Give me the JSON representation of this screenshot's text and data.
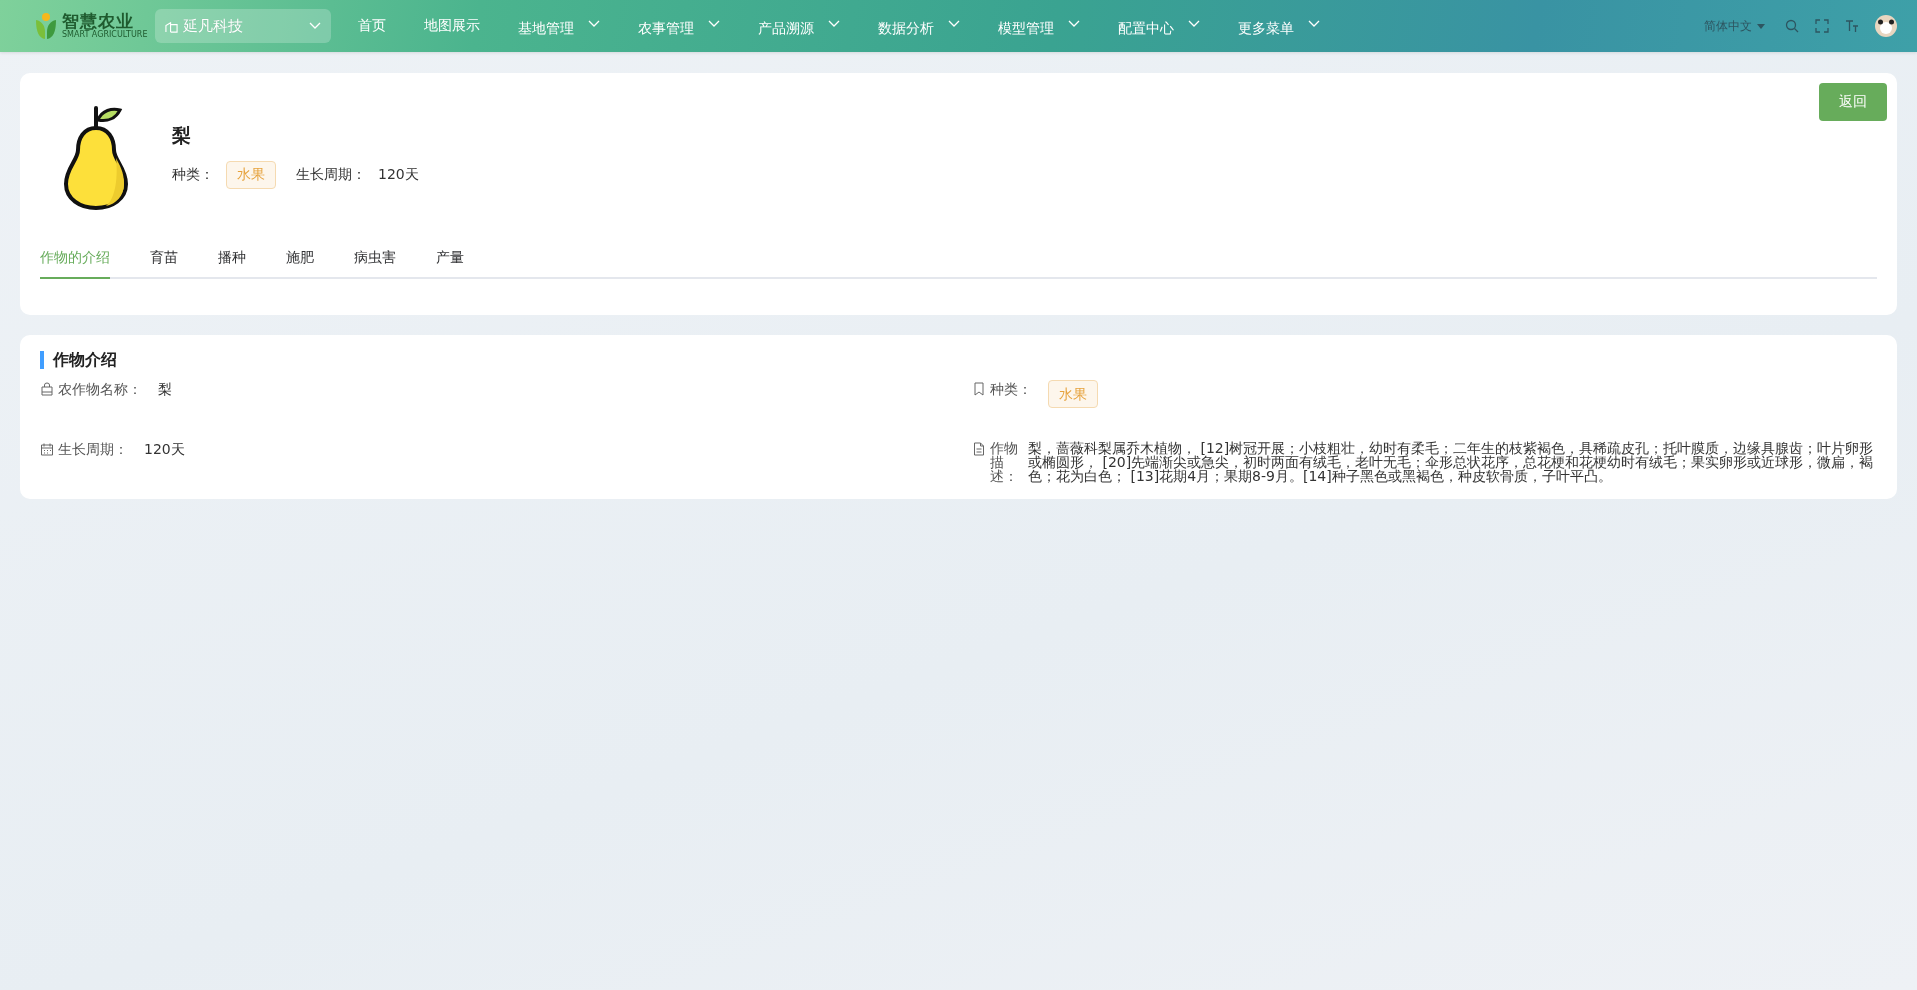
{
  "header": {
    "logo": {
      "title": "智慧农业",
      "subtitle": "SMART AGRICULTURE"
    },
    "org_select": {
      "value": "延凡科技"
    },
    "nav": [
      {
        "label": "首页",
        "has_menu": false
      },
      {
        "label": "地图展示",
        "has_menu": false
      },
      {
        "label": "基地管理",
        "has_menu": true
      },
      {
        "label": "农事管理",
        "has_menu": true
      },
      {
        "label": "产品溯源",
        "has_menu": true
      },
      {
        "label": "数据分析",
        "has_menu": true
      },
      {
        "label": "模型管理",
        "has_menu": true
      },
      {
        "label": "配置中心",
        "has_menu": true
      },
      {
        "label": "更多菜单",
        "has_menu": true
      }
    ],
    "language": "简体中文"
  },
  "crop": {
    "name": "梨",
    "category_label": "种类：",
    "category": "水果",
    "cycle_label": "生长周期：",
    "cycle": "120天",
    "back_button": "返回",
    "tabs": [
      {
        "label": "作物的介绍",
        "selected": true
      },
      {
        "label": "育苗",
        "selected": false
      },
      {
        "label": "播种",
        "selected": false
      },
      {
        "label": "施肥",
        "selected": false
      },
      {
        "label": "病虫害",
        "selected": false
      },
      {
        "label": "产量",
        "selected": false
      }
    ]
  },
  "intro": {
    "title": "作物介绍",
    "fields": [
      {
        "kind": "text",
        "label": "农作物名称：",
        "value": "梨"
      },
      {
        "kind": "tag",
        "label": "种类：",
        "value": "水果"
      },
      {
        "kind": "text",
        "label": "生长周期：",
        "value": "120天"
      },
      {
        "kind": "long",
        "label": "作物描述：",
        "value": "梨，蔷薇科梨属乔木植物， [12]树冠开展；小枝粗壮，幼时有柔毛；二年生的枝紫褐色，具稀疏皮孔；托叶膜质，边缘具腺齿；叶片卵形或椭圆形， [20]先端渐尖或急尖，初时两面有绒毛，老叶无毛；伞形总状花序，总花梗和花梗幼时有绒毛；果实卵形或近球形，微扁，褐色；花为白色； [13]花期4月；果期8-9月。[14]种子黑色或黑褐色，种皮软骨质，子叶平凸。"
      }
    ]
  }
}
